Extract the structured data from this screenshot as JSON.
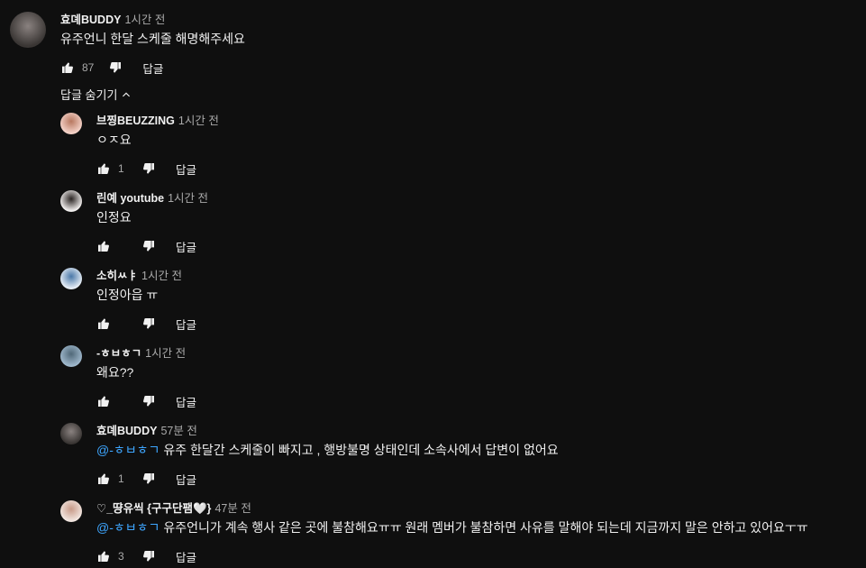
{
  "comments": [
    {
      "author": "효뎨BUDDY",
      "time": "1시간 전",
      "text": "유주언니 한달 스케줄 해명해주세요",
      "likes": "87",
      "reply_label": "답글",
      "avatar_colors": [
        "#3a3634",
        "#8a8280"
      ]
    }
  ],
  "replies_toggle": {
    "label": "답글 숨기기"
  },
  "replies": [
    {
      "author": "브찡BEUZZING",
      "time": "1시간 전",
      "text": "ㅇㅈ요",
      "likes": "1",
      "reply_label": "답글",
      "avatar_colors": [
        "#f4d2c8",
        "#b87860"
      ]
    },
    {
      "author": "린예 youtube",
      "time": "1시간 전",
      "text": "인정요",
      "likes": "",
      "reply_label": "답글",
      "avatar_colors": [
        "#f2efee",
        "#2a2422"
      ]
    },
    {
      "author": "소히ㅆㅑ",
      "time": "1시간 전",
      "text": "인정아읍 ㅠ",
      "likes": "",
      "reply_label": "답글",
      "avatar_colors": [
        "#e7eef6",
        "#4a78a8"
      ]
    },
    {
      "author": "-ㅎㅂㅎㄱ",
      "time": "1시간 전",
      "text": "왜요??",
      "likes": "",
      "reply_label": "답글",
      "avatar_colors": [
        "#9fb8cc",
        "#506878"
      ]
    },
    {
      "author": "효뎨BUDDY",
      "time": "57분 전",
      "mention": "@-ㅎㅂㅎㄱ",
      "text": "유주 한달간 스케줄이 빠지고 , 행방불명 상태인데 소속사에서 답변이 없어요",
      "likes": "1",
      "reply_label": "답글",
      "avatar_colors": [
        "#3a3634",
        "#8a8280"
      ]
    },
    {
      "author": "♡_땽유씩 {구구단팸🤍}",
      "time": "47분 전",
      "mention": "@-ㅎㅂㅎㄱ",
      "text": "유주언니가 계속 행사 같은 곳에 불참해요ㅠㅠ 원래 멤버가 불참하면 사유를 말해야 되는데 지금까지 말은 안하고 있어요ㅜㅠ",
      "likes": "3",
      "reply_label": "답글",
      "avatar_colors": [
        "#f2e6e0",
        "#c89a88"
      ]
    }
  ]
}
